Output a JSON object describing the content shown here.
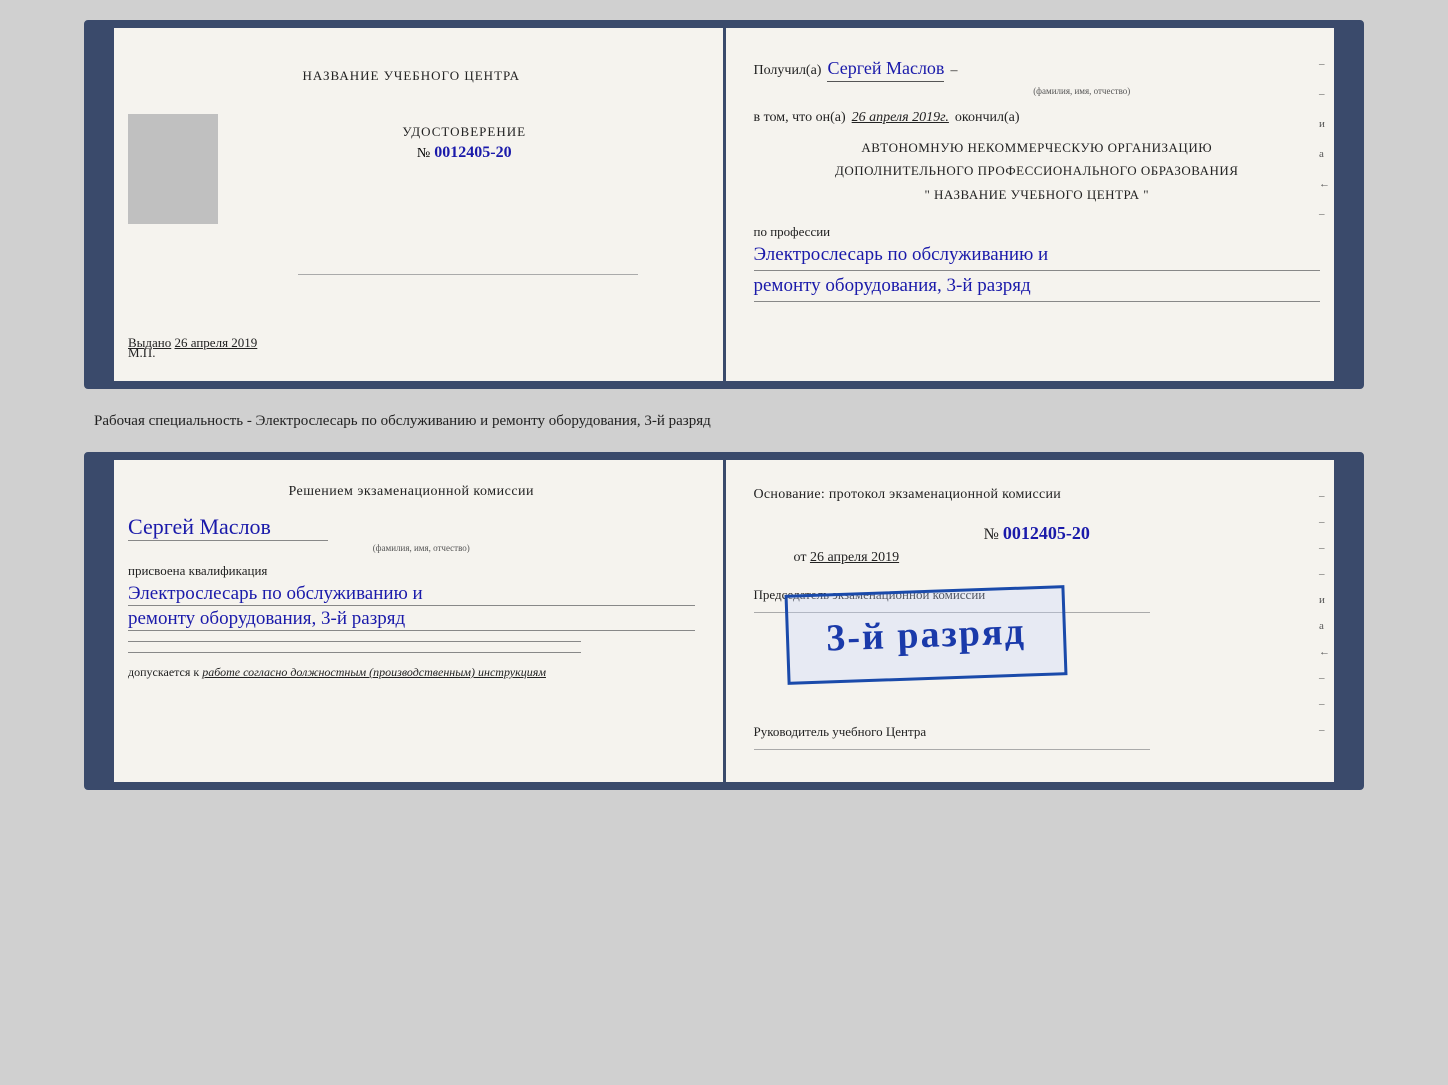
{
  "cert1": {
    "left": {
      "center_title": "НАЗВАНИЕ УЧЕБНОГО ЦЕНТРА",
      "cert_label": "УДОСТОВЕРЕНИЕ",
      "cert_number_prefix": "№",
      "cert_number": "0012405-20",
      "issued_label": "Выдано",
      "issued_date": "26 апреля 2019",
      "mp_label": "М.П."
    },
    "right": {
      "received_label": "Получил(а)",
      "received_name": "Сергей Маслов",
      "fio_hint": "(фамилия, имя, отчество)",
      "vtom_label": "в том, что он(а)",
      "vtom_date": "26 апреля 2019г.",
      "finished_label": "окончил(а)",
      "org_line1": "АВТОНОМНУЮ НЕКОММЕРЧЕСКУЮ ОРГАНИЗАЦИЮ",
      "org_line2": "ДОПОЛНИТЕЛЬНОГО ПРОФЕССИОНАЛЬНОГО ОБРАЗОВАНИЯ",
      "org_name": "\"    НАЗВАНИЕ УЧЕБНОГО ЦЕНТРА    \"",
      "profession_label": "по профессии",
      "profession_line1": "Электрослесарь по обслуживанию и",
      "profession_line2": "ремонту оборудования, 3-й разряд",
      "side_marks": [
        "–",
        "–",
        "и",
        "а",
        "←",
        "–"
      ]
    }
  },
  "caption": {
    "text": "Рабочая специальность - Электрослесарь по обслуживанию и ремонту оборудования, 3-й разряд"
  },
  "cert2": {
    "left": {
      "resolution_title": "Решением экзаменационной комиссии",
      "person_name": "Сергей Маслов",
      "fio_hint": "(фамилия, имя, отчество)",
      "qualification_label": "присвоена квалификация",
      "qual_line1": "Электрослесарь по обслуживанию и",
      "qual_line2": "ремонту оборудования, 3-й разряд",
      "dopusk_label": "допускается к",
      "dopusk_text": "работе согласно должностным (производственным) инструкциям"
    },
    "right": {
      "osnov_label": "Основание: протокол экзаменационной комиссии",
      "number_prefix": "№",
      "number": "0012405-20",
      "date_prefix": "от",
      "date": "26 апреля 2019",
      "chairman_label": "Председатель экзаменационной комиссии",
      "rukov_label": "Руководитель учебного Центра",
      "stamp_text": "3-й разряд",
      "side_marks": [
        "–",
        "–",
        "–",
        "–",
        "и",
        "а",
        "←",
        "–",
        "–",
        "–"
      ]
    }
  }
}
